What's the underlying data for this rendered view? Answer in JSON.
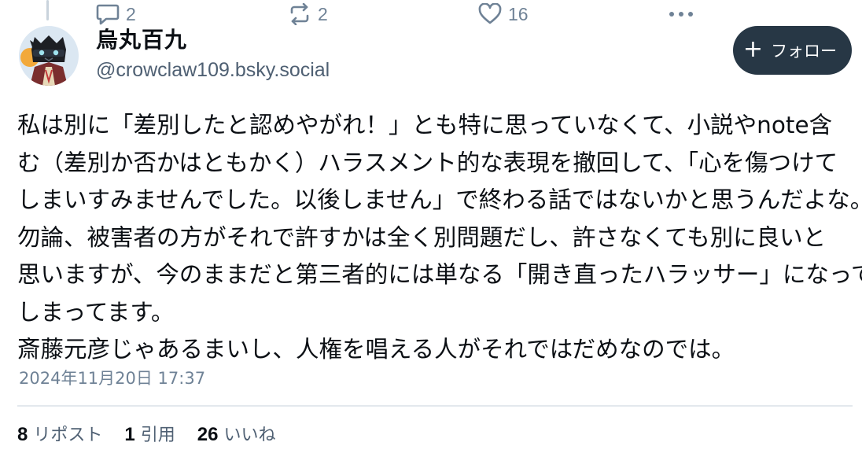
{
  "parent_actions": {
    "reply_count": "2",
    "repost_count": "2",
    "like_count": "16",
    "more_label": "•••",
    "icons": [
      "reply-icon",
      "repost-icon",
      "heart-icon",
      "more-icon"
    ]
  },
  "author": {
    "display_name": "烏丸百九",
    "handle": "@crowclaw109.bsky.social",
    "avatar": "crow-avatar"
  },
  "follow_button": {
    "icon": "plus-icon",
    "plus": "+",
    "label": "フォロー"
  },
  "post": {
    "lines": [
      "私は別に「差別したと認めやがれ！」とも特に思っていなくて、小説やnote含",
      "む（差別か否かはともかく）ハラスメント的な表現を撤回して、「心を傷つけて",
      "しまいすみませんでした。以後しません」で終わる話ではないかと思うんだよな。",
      "勿論、被害者の方がそれで許すかは全く別問題だし、許さなくても別に良いと",
      "思いますが、今のままだと第三者的には単なる「開き直ったハラッサー」になって",
      "しまってます。",
      "斎藤元彦じゃあるまいし、人権を唱える人がそれではだめなのでは。"
    ],
    "timestamp": "2024年11月20日 17:37"
  },
  "stats": {
    "reposts": {
      "count": "8",
      "label": "リポスト"
    },
    "quotes": {
      "count": "1",
      "label": "引用"
    },
    "likes": {
      "count": "26",
      "label": "いいね"
    }
  },
  "colors": {
    "text_primary": "#0b0f14",
    "text_muted": "#6f8296",
    "follow_button_bg": "#273745",
    "divider": "#e3e8ed"
  }
}
